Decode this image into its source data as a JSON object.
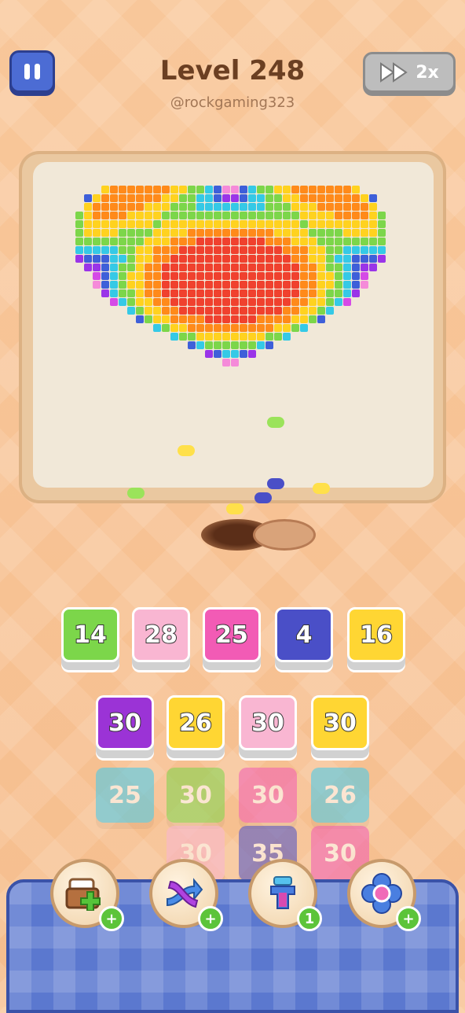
{
  "header": {
    "title": "Level 248",
    "handle": "@rockgaming323",
    "speed_label": "2x"
  },
  "board": {
    "heart_colors": [
      "#f0412e",
      "#ff8a1a",
      "#ffd21f",
      "#7cd64a",
      "#35c9e6",
      "#3e5fd9",
      "#9a34e8",
      "#d54ae6",
      "#f58ad9",
      "#fbb8e0"
    ]
  },
  "queue": [
    {
      "value": "14",
      "color": "#7cd64a"
    },
    {
      "value": "28",
      "color": "#f9b6d2"
    },
    {
      "value": "25",
      "color": "#f25bb5"
    },
    {
      "value": "4",
      "color": "#4a4fc7"
    },
    {
      "value": "16",
      "color": "#ffd633"
    }
  ],
  "grid": {
    "row1": [
      {
        "value": "30",
        "color": "#9b33d6"
      },
      {
        "value": "26",
        "color": "#ffd633"
      },
      {
        "value": "30",
        "color": "#f9b6d2"
      },
      {
        "value": "30",
        "color": "#ffd633"
      }
    ],
    "row2": [
      {
        "value": "25",
        "color": "#3fcbee"
      },
      {
        "value": "30",
        "color": "#7cd64a"
      },
      {
        "value": "30",
        "color": "#f25bb5"
      },
      {
        "value": "26",
        "color": "#3fcbee"
      }
    ],
    "row3": [
      {
        "value": "30",
        "color": "#f9b6d2"
      },
      {
        "value": "35",
        "color": "#4a4fc7"
      },
      {
        "value": "30",
        "color": "#f25bb5"
      }
    ]
  },
  "boosters": [
    {
      "icon": "add-slot-icon",
      "badge": "+"
    },
    {
      "icon": "shuffle-icon",
      "badge": "+"
    },
    {
      "icon": "magnet-icon",
      "badge": "1"
    },
    {
      "icon": "flower-icon",
      "badge": "+"
    }
  ]
}
